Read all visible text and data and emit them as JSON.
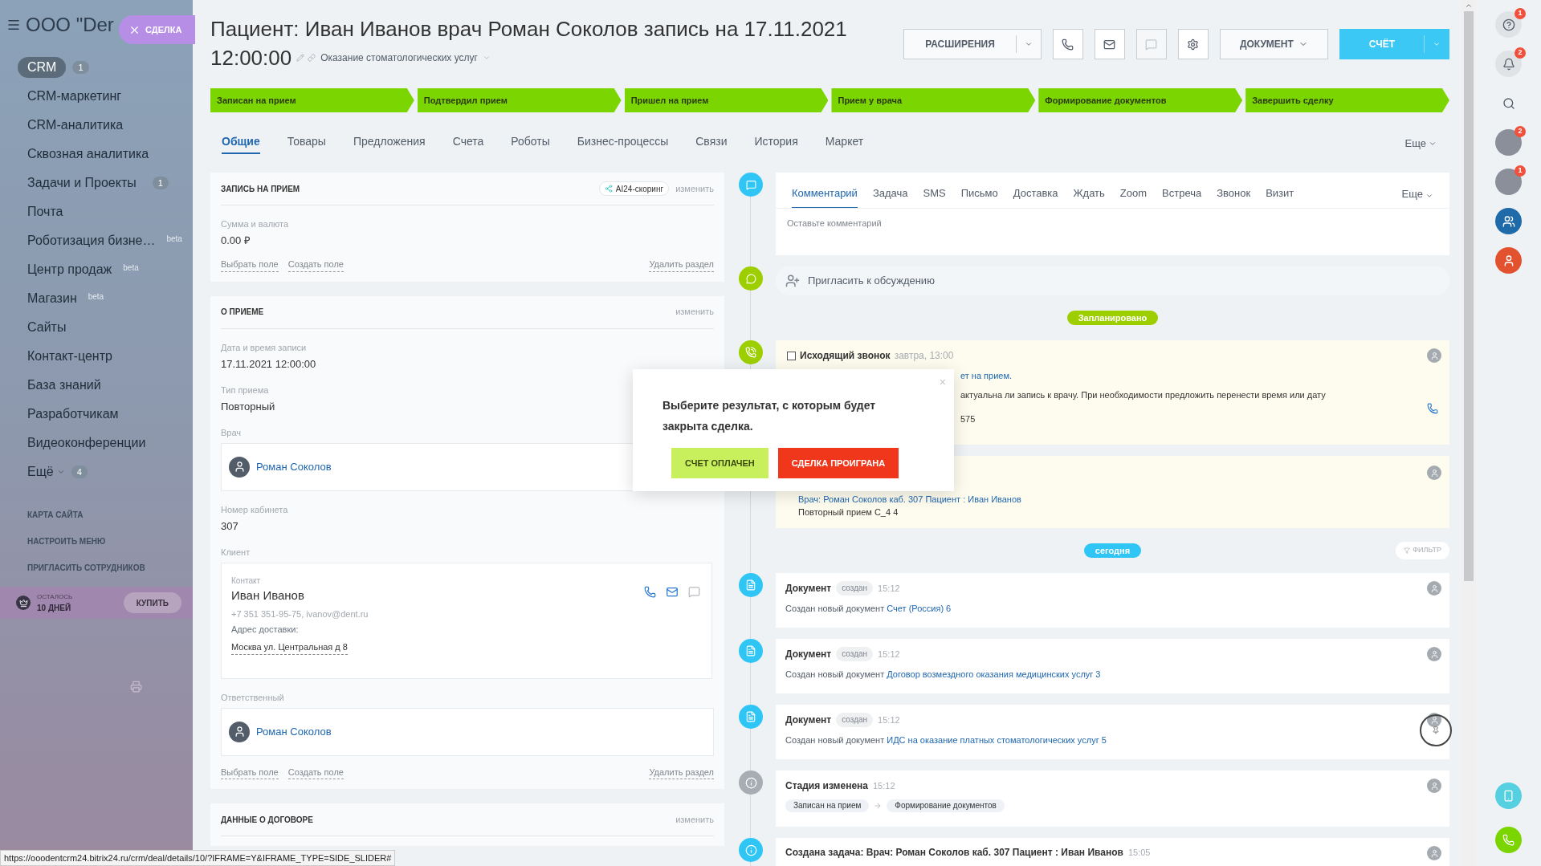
{
  "sidebar": {
    "company": "ООО \"Der",
    "close_tab": {
      "label": "СДЕЛКА"
    },
    "items": [
      {
        "label": "CRM",
        "selected": true,
        "counter": "1",
        "expandable": false
      },
      {
        "label": "CRM-маркетинг",
        "selected": false,
        "expandable": false
      },
      {
        "label": "CRM-аналитика",
        "selected": false,
        "expandable": false
      },
      {
        "label": "Сквозная аналитика",
        "selected": false,
        "expandable": false
      },
      {
        "label": "Задачи и Проекты",
        "selected": false,
        "counter": "1",
        "expandable": false
      },
      {
        "label": "Почта",
        "selected": false,
        "expandable": false
      },
      {
        "label": "Роботизация бизне…",
        "selected": false,
        "tag": "beta",
        "expandable": false
      },
      {
        "label": "Центр продаж",
        "selected": false,
        "tag": "beta",
        "expandable": false
      },
      {
        "label": "Магазин",
        "selected": false,
        "tag": "beta",
        "expandable": false
      },
      {
        "label": "Сайты",
        "selected": false,
        "expandable": false
      },
      {
        "label": "Контакт-центр",
        "selected": false,
        "expandable": false
      },
      {
        "label": "База знаний",
        "selected": false,
        "expandable": false
      },
      {
        "label": "Разработчикам",
        "selected": false,
        "expandable": false
      },
      {
        "label": "Видеоконференции",
        "selected": false,
        "expandable": false
      },
      {
        "label": "Ещё",
        "selected": false,
        "counter": "4",
        "expandable": true
      }
    ],
    "links": [
      "КАРТА САЙТА",
      "НАСТРОИТЬ МЕНЮ",
      "ПРИГЛАСИТЬ СОТРУДНИКОВ"
    ],
    "license": {
      "caption": "ОСТАЛОСЬ",
      "days": "10 ДНЕЙ",
      "button": "КУПИТЬ"
    }
  },
  "header": {
    "title_lines": [
      "Пациент: Иван Иванов врач Роман Соколов запись на 17.11.2021",
      "12:00:00"
    ],
    "service": "Оказание стоматологических услуг",
    "buttons": [
      {
        "kind": "split",
        "label": "РАСШИРЕНИЯ",
        "primary": false
      },
      {
        "kind": "icon",
        "disabled": false
      },
      {
        "kind": "icon",
        "disabled": false
      },
      {
        "kind": "icon",
        "disabled": true
      },
      {
        "kind": "icon",
        "disabled": false
      },
      {
        "kind": "menu",
        "label": "ДОКУМЕНТ",
        "primary": false
      },
      {
        "kind": "split",
        "label": "СЧЁТ",
        "primary": true
      }
    ]
  },
  "stages": [
    {
      "label": "Записан на прием",
      "passed": true
    },
    {
      "label": "Подтвердил прием",
      "passed": true
    },
    {
      "label": "Пришел на прием",
      "passed": true
    },
    {
      "label": "Прием у врача",
      "passed": true
    },
    {
      "label": "Формирование документов",
      "passed": true
    },
    {
      "label": "Завершить сделку",
      "passed": true
    }
  ],
  "tabs": [
    {
      "label": "Общие",
      "selected": true
    },
    {
      "label": "Товары",
      "selected": false
    },
    {
      "label": "Предложения",
      "selected": false
    },
    {
      "label": "Счета",
      "selected": false
    },
    {
      "label": "Роботы",
      "selected": false
    },
    {
      "label": "Бизнес-процессы",
      "selected": false
    },
    {
      "label": "Связи",
      "selected": false
    },
    {
      "label": "История",
      "selected": false
    },
    {
      "label": "Маркет",
      "selected": false
    }
  ],
  "tabs_more": "Еще",
  "sections": [
    {
      "title": "ЗАПИСЬ НА ПРИЕМ",
      "badge": "AI24-скоринг",
      "edit": "изменить",
      "fields": [
        {
          "kind": "text",
          "label": "Сумма и валюта",
          "value": "0.00 ₽"
        }
      ],
      "footer": {
        "select": "Выбрать поле",
        "create": "Создать поле",
        "delete": "Удалить раздел"
      }
    },
    {
      "title": "О ПРИЕМЕ",
      "edit": "изменить",
      "fields": [
        {
          "kind": "text",
          "label": "Дата и время записи",
          "value": "17.11.2021 12:00:00"
        },
        {
          "kind": "text",
          "label": "Тип приема",
          "value": "Повторный"
        },
        {
          "kind": "person",
          "label": "Врач",
          "value": "Роман Соколов"
        },
        {
          "kind": "text",
          "label": "Номер кабинета",
          "value": "307"
        },
        {
          "kind": "contact",
          "label": "Клиент",
          "caption": "Контакт",
          "value": "Иван Иванов",
          "details": "+7 351 351-95-75, ivanov@dent.ru",
          "address_label": "Адрес доставки:",
          "address": "Москва ул. Центральная д 8"
        },
        {
          "kind": "person",
          "label": "Ответственный",
          "value": "Роман Соколов"
        }
      ],
      "footer": {
        "select": "Выбрать поле",
        "create": "Создать поле",
        "delete": "Удалить раздел"
      }
    },
    {
      "title": "ДАННЫЕ О ДОГОВОРЕ",
      "edit": "изменить"
    }
  ],
  "composer": {
    "tabs": [
      {
        "label": "Комментарий",
        "selected": true
      },
      {
        "label": "Задача",
        "selected": false
      },
      {
        "label": "SMS",
        "selected": false
      },
      {
        "label": "Письмо",
        "selected": false
      },
      {
        "label": "Доставка",
        "selected": false
      },
      {
        "label": "Ждать",
        "selected": false
      },
      {
        "label": "Zoom",
        "selected": false
      },
      {
        "label": "Встреча",
        "selected": false
      },
      {
        "label": "Звонок",
        "selected": false
      },
      {
        "label": "Визит",
        "selected": false
      }
    ],
    "more": "Еще",
    "placeholder": "Оставьте комментарий"
  },
  "invite": {
    "label": "Пригласить к обсуждению"
  },
  "timeline": [
    {
      "kind": "divider",
      "label": "Запланировано",
      "color": "#9dcf00"
    },
    {
      "kind": "call",
      "checked": false,
      "title": "Исходящий звонок",
      "time": "завтра, 13:00",
      "lines": [
        {
          "text": "ет на прием.",
          "link": true
        },
        {
          "text": "актуальна ли запись к врачу. При необходимости предложить перенести время или дату",
          "link": false
        },
        {
          "text": "575",
          "link": false
        }
      ]
    },
    {
      "kind": "task",
      "lines": [
        {
          "text": "Врач: Роман Соколов каб. 307 Пациент : Иван Иванов",
          "link": true
        },
        {
          "text": "Повторный прием С_4 4",
          "link": false
        }
      ]
    },
    {
      "kind": "divider",
      "label": "сегодня",
      "color": "#2fc6f6",
      "filter": "ФИЛЬТР"
    },
    {
      "kind": "document",
      "title": "Документ",
      "status": "создан",
      "time": "15:12",
      "text": "Создан новый документ",
      "link": "Счет (Россия) 6",
      "hovered": false
    },
    {
      "kind": "document",
      "title": "Документ",
      "status": "создан",
      "time": "15:12",
      "text": "Создан новый документ",
      "link": "Договор возмездного оказания медицинских услуг 3",
      "hovered": false
    },
    {
      "kind": "document",
      "title": "Документ",
      "status": "создан",
      "time": "15:12",
      "text": "Создан новый документ",
      "link": "ИДС на оказание платных стоматологических услуг 5",
      "hovered": true
    },
    {
      "kind": "stage",
      "title": "Стадия изменена",
      "time": "15:12",
      "from": "Записан на прием",
      "to": "Формирование документов"
    },
    {
      "kind": "created_task",
      "title": "Создана задача: Врач: Роман Соколов каб. 307 Пациент : Иван Иванов",
      "time": "15:05"
    }
  ],
  "popup": {
    "text": "Выберите результат, с которым будет закрыта сделка.",
    "close": "×",
    "buttons": [
      {
        "kind": "success",
        "label": "СЧЕТ ОПЛАЧЕН"
      },
      {
        "kind": "failure",
        "label": "СДЕЛКА ПРОИГРАНА"
      }
    ]
  },
  "rail": [
    {
      "kind": "icon",
      "badge": "1"
    },
    {
      "kind": "icon",
      "badge": "2"
    },
    {
      "kind": "icon"
    },
    {
      "kind": "avatar",
      "badge": "2"
    },
    {
      "kind": "avatar",
      "badge": "1"
    },
    {
      "kind": "icon"
    },
    {
      "kind": "icon"
    }
  ],
  "status_bar": {
    "url": "https://ooodentcrm24.bitrix24.ru/crm/deal/details/10/?IFRAME=Y&IFRAME_TYPE=SIDE_SLIDER#"
  }
}
